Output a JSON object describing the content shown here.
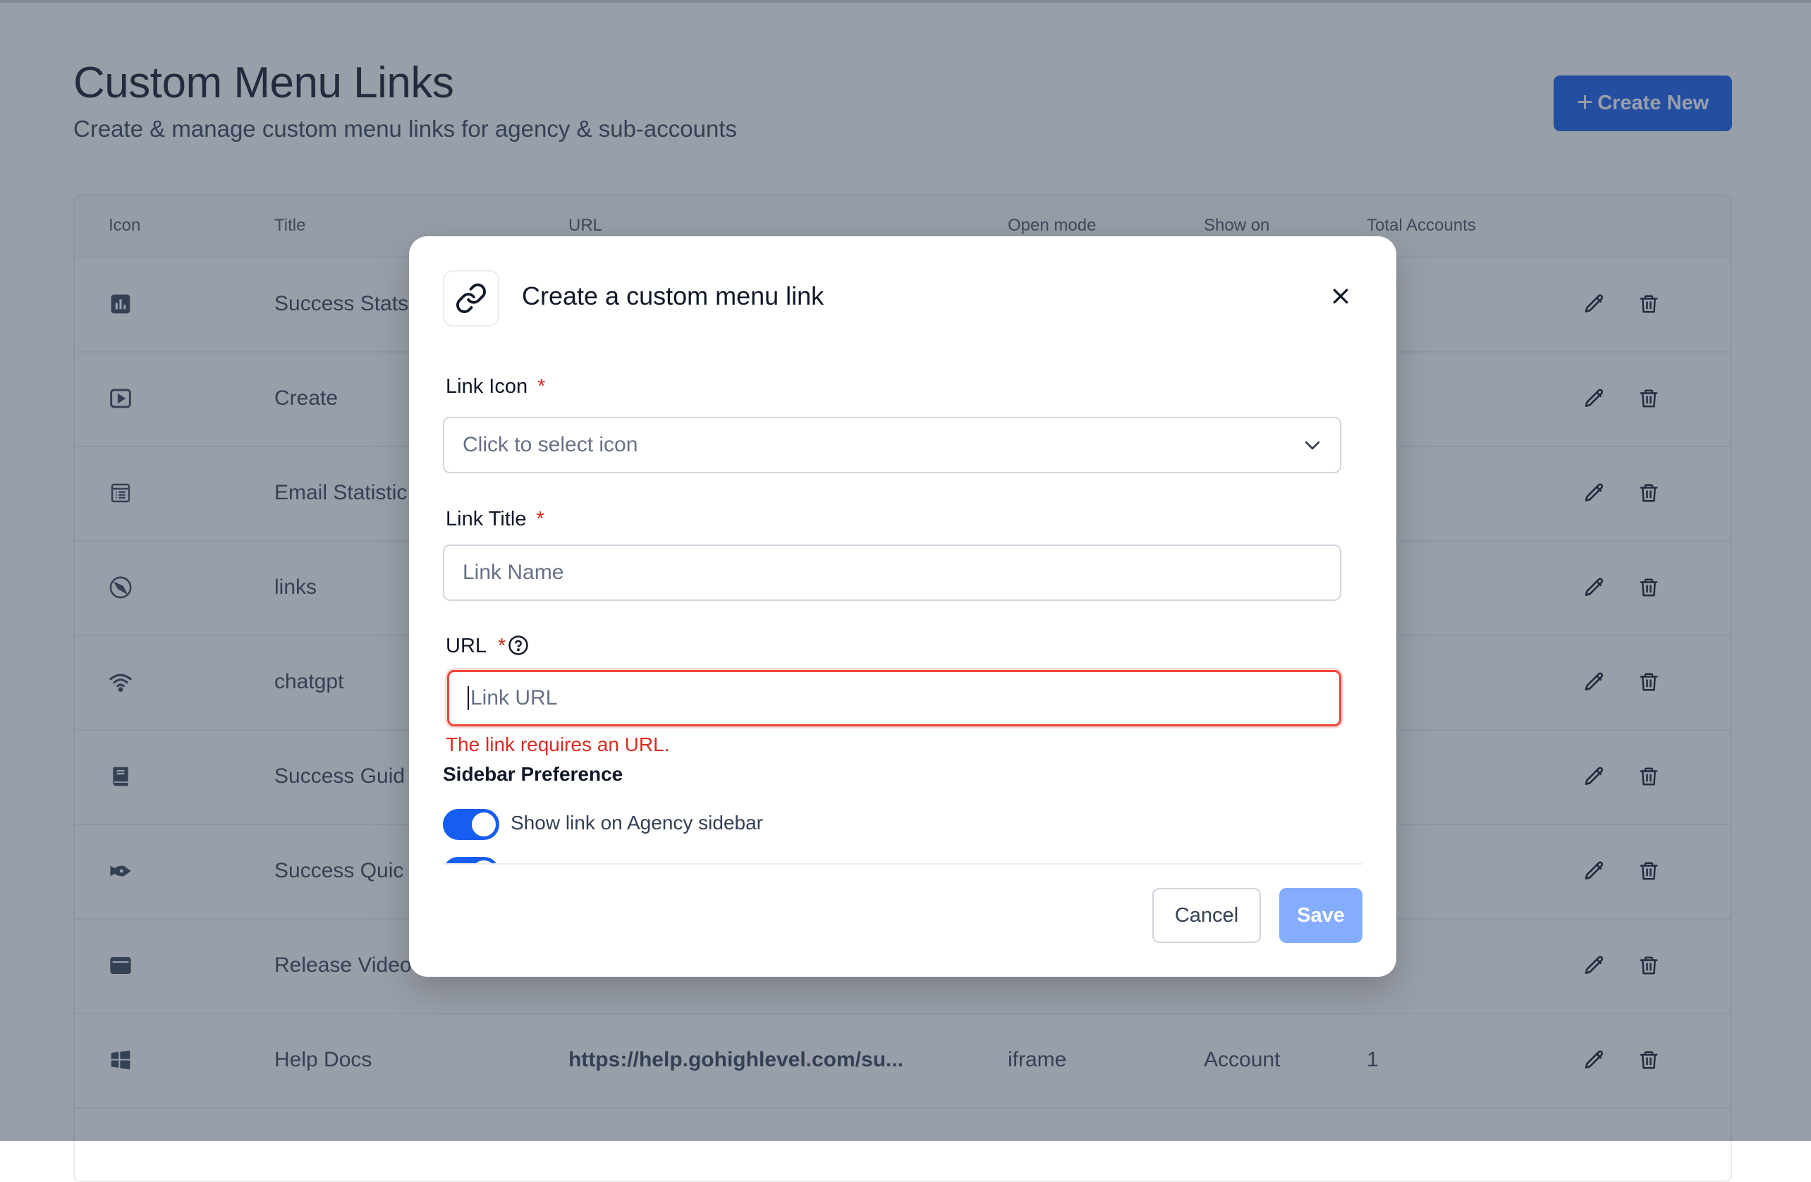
{
  "header": {
    "title": "Custom Menu Links",
    "subtitle": "Create & manage custom menu links for agency & sub-accounts",
    "create_label": "Create New"
  },
  "table": {
    "columns": [
      "Icon",
      "Title",
      "URL",
      "Open mode",
      "Show on",
      "Total Accounts"
    ],
    "rows": [
      {
        "icon": "bar-chart-icon",
        "title": "Success Stats",
        "url": "",
        "open_mode": "",
        "show_on": "",
        "total": ""
      },
      {
        "icon": "video-play-icon",
        "title": "Create",
        "url": "",
        "open_mode": "",
        "show_on": "",
        "total": ""
      },
      {
        "icon": "list-document-icon",
        "title": "Email Statistic",
        "url": "",
        "open_mode": "",
        "show_on": "",
        "total": ""
      },
      {
        "icon": "compass-icon",
        "title": "links",
        "url": "",
        "open_mode": "",
        "show_on": "",
        "total": ""
      },
      {
        "icon": "wifi-icon",
        "title": "chatgpt",
        "url": "",
        "open_mode": "",
        "show_on": "",
        "total": ""
      },
      {
        "icon": "book-icon",
        "title": "Success Guid",
        "url": "",
        "open_mode": "",
        "show_on": "",
        "total": ""
      },
      {
        "icon": "rocket-icon",
        "title": "Success Quic",
        "url": "",
        "open_mode": "",
        "show_on": "",
        "total": ""
      },
      {
        "icon": "browser-window-icon",
        "title": "Release Video",
        "url": "",
        "open_mode": "",
        "show_on": "",
        "total": ""
      },
      {
        "icon": "windows-logo-icon",
        "title": "Help Docs",
        "url": "https://help.gohighlevel.com/su...",
        "open_mode": "iframe",
        "show_on": "Account",
        "total": "1"
      }
    ]
  },
  "modal": {
    "title": "Create a custom menu link",
    "link_icon_label": "Link Icon",
    "link_icon_placeholder": "Click to select icon",
    "link_title_label": "Link Title",
    "link_title_placeholder": "Link Name",
    "url_label": "URL",
    "url_placeholder": "Link URL",
    "required_mark": "*",
    "url_error": "The link requires an URL.",
    "sidebar_pref_title": "Sidebar Preference",
    "agency_toggle_label": "Show link on Agency sidebar",
    "agency_toggle_on": true,
    "cancel_label": "Cancel",
    "save_label": "Save"
  },
  "colors": {
    "primary": "#155eef",
    "save_disabled": "#84adff",
    "error": "#d92d20",
    "overlay": "rgba(52,64,84,0.5)"
  }
}
